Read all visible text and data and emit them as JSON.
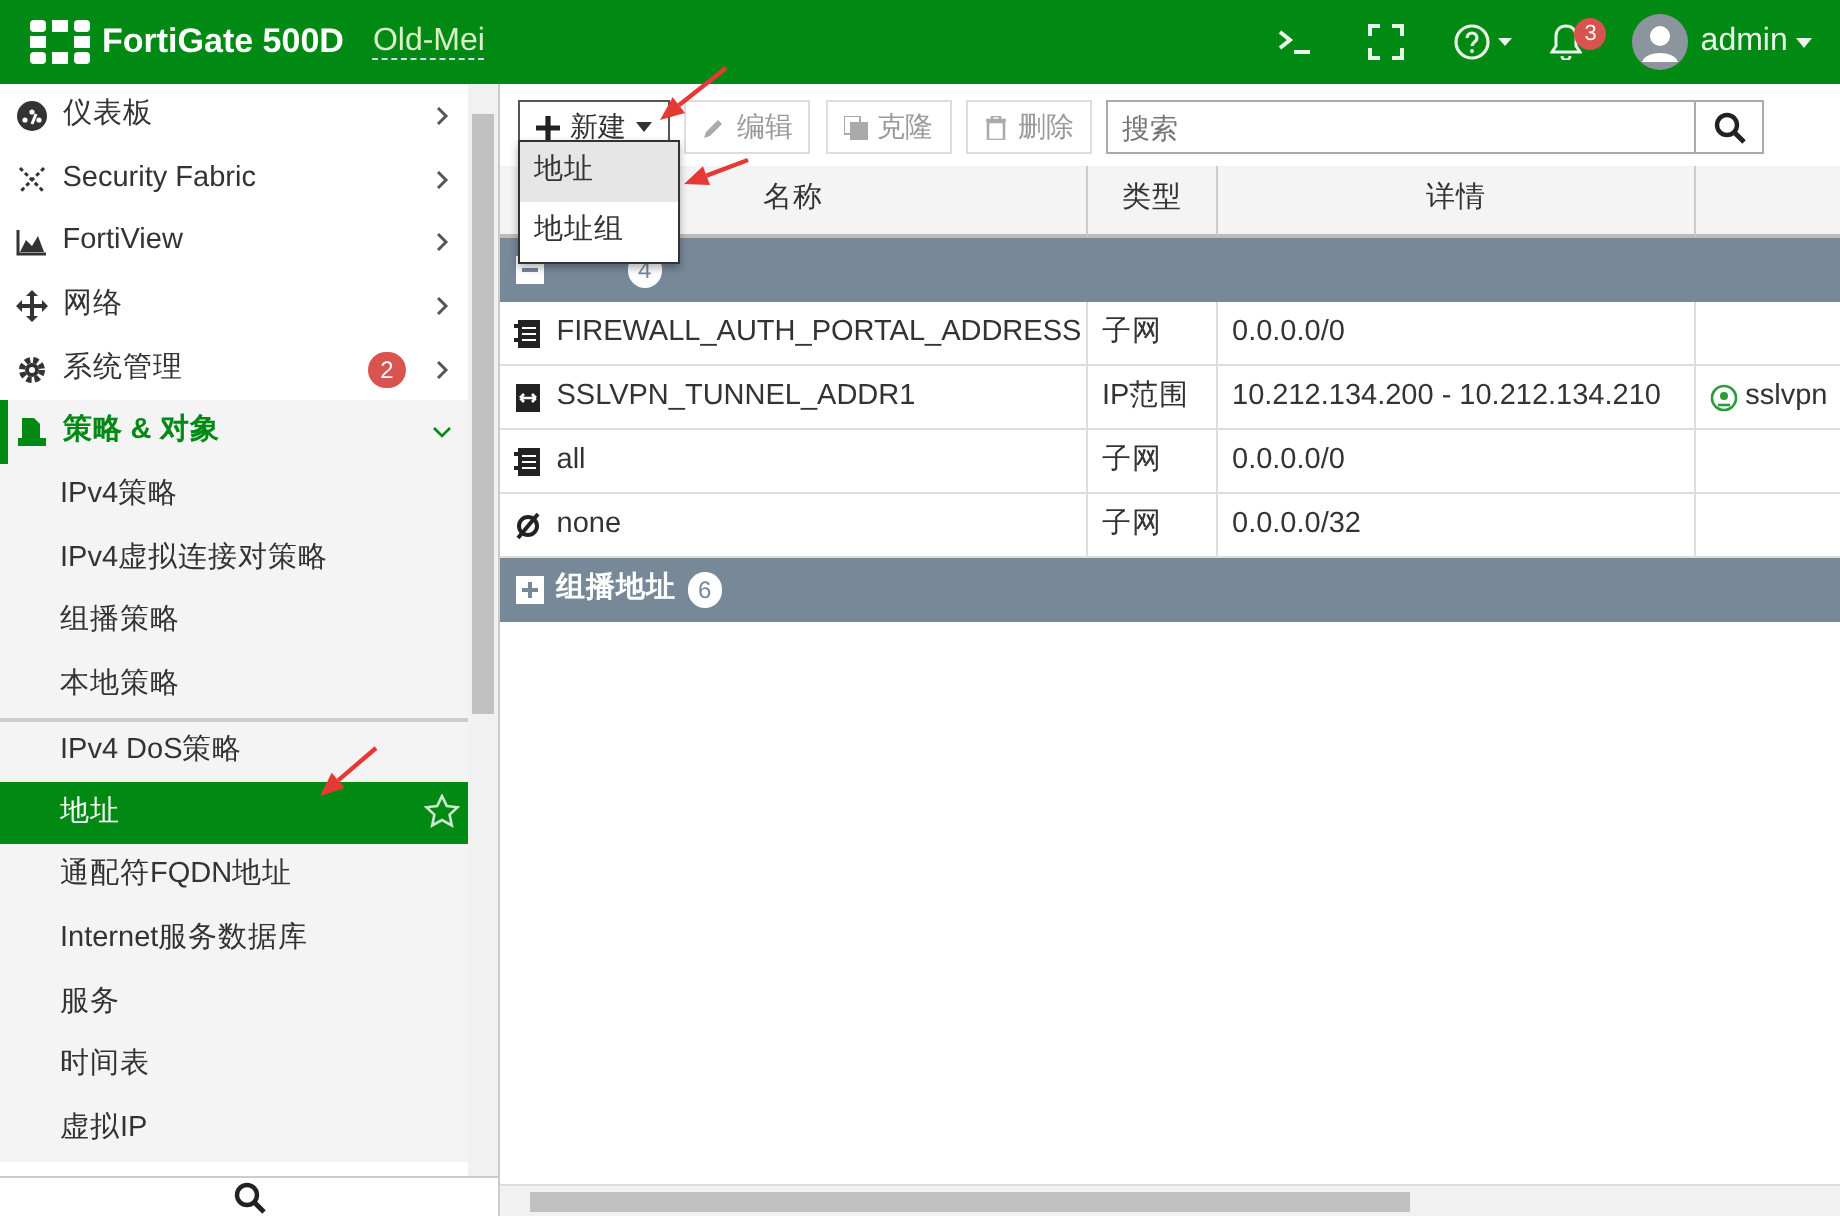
{
  "header": {
    "product": "FortiGate 500D",
    "hostname": "Old-Mei",
    "notifications": "3",
    "user": "admin"
  },
  "sidebar": {
    "items": [
      {
        "kind": "section",
        "label": "仪表板",
        "expanded": false
      },
      {
        "kind": "section",
        "label": "Security Fabric",
        "expanded": false
      },
      {
        "kind": "section",
        "label": "FortiView",
        "expanded": false
      },
      {
        "kind": "section",
        "label": "网络",
        "expanded": false
      },
      {
        "kind": "section",
        "label": "系统管理",
        "expanded": false,
        "badge": "2"
      },
      {
        "kind": "section",
        "label": "策略 & 对象",
        "expanded": true
      },
      {
        "kind": "sub",
        "label": "IPv4策略",
        "selected": false
      },
      {
        "kind": "sub",
        "label": "IPv4虚拟连接对策略",
        "selected": false
      },
      {
        "kind": "sub",
        "label": "组播策略",
        "selected": false
      },
      {
        "kind": "sub",
        "label": "本地策略",
        "selected": false
      },
      {
        "kind": "sub",
        "label": "IPv4 DoS策略",
        "selected": false
      },
      {
        "kind": "sub",
        "label": "地址",
        "selected": true
      },
      {
        "kind": "sub",
        "label": "通配符FQDN地址",
        "selected": false
      },
      {
        "kind": "sub",
        "label": "Internet服务数据库",
        "selected": false
      },
      {
        "kind": "sub",
        "label": "服务",
        "selected": false
      },
      {
        "kind": "sub",
        "label": "时间表",
        "selected": false
      },
      {
        "kind": "sub",
        "label": "虚拟IP",
        "selected": false
      }
    ]
  },
  "toolbar": {
    "buttons": [
      {
        "label": "新建",
        "disabled": false,
        "expanded": true
      },
      {
        "label": "编辑",
        "disabled": true
      },
      {
        "label": "克隆",
        "disabled": true
      },
      {
        "label": "删除",
        "disabled": true
      }
    ],
    "search": {
      "placeholder": "搜索"
    },
    "menu": [
      {
        "label": "地址",
        "selected": true
      },
      {
        "label": "地址组",
        "selected": false
      }
    ]
  },
  "table": {
    "columns": [
      "名称",
      "类型",
      "详情"
    ],
    "groups": [
      {
        "count": "4",
        "expanded": true,
        "rows": [
          {
            "kind": "subnet",
            "name": "FIREWALL_AUTH_PORTAL_ADDRESS",
            "type": "子网",
            "detail": "0.0.0.0/0"
          },
          {
            "kind": "range",
            "name": "SSLVPN_TUNNEL_ADDR1",
            "type": "IP范围",
            "detail": "10.212.134.200 - 10.212.134.210",
            "column_4": "sslvpn"
          },
          {
            "kind": "subnet",
            "name": "all",
            "type": "子网",
            "detail": "0.0.0.0/0"
          },
          {
            "kind": "none",
            "name": "none",
            "type": "子网",
            "detail": "0.0.0.0/32"
          }
        ]
      },
      {
        "label": "组播地址",
        "count": "6",
        "expanded": false
      }
    ]
  }
}
